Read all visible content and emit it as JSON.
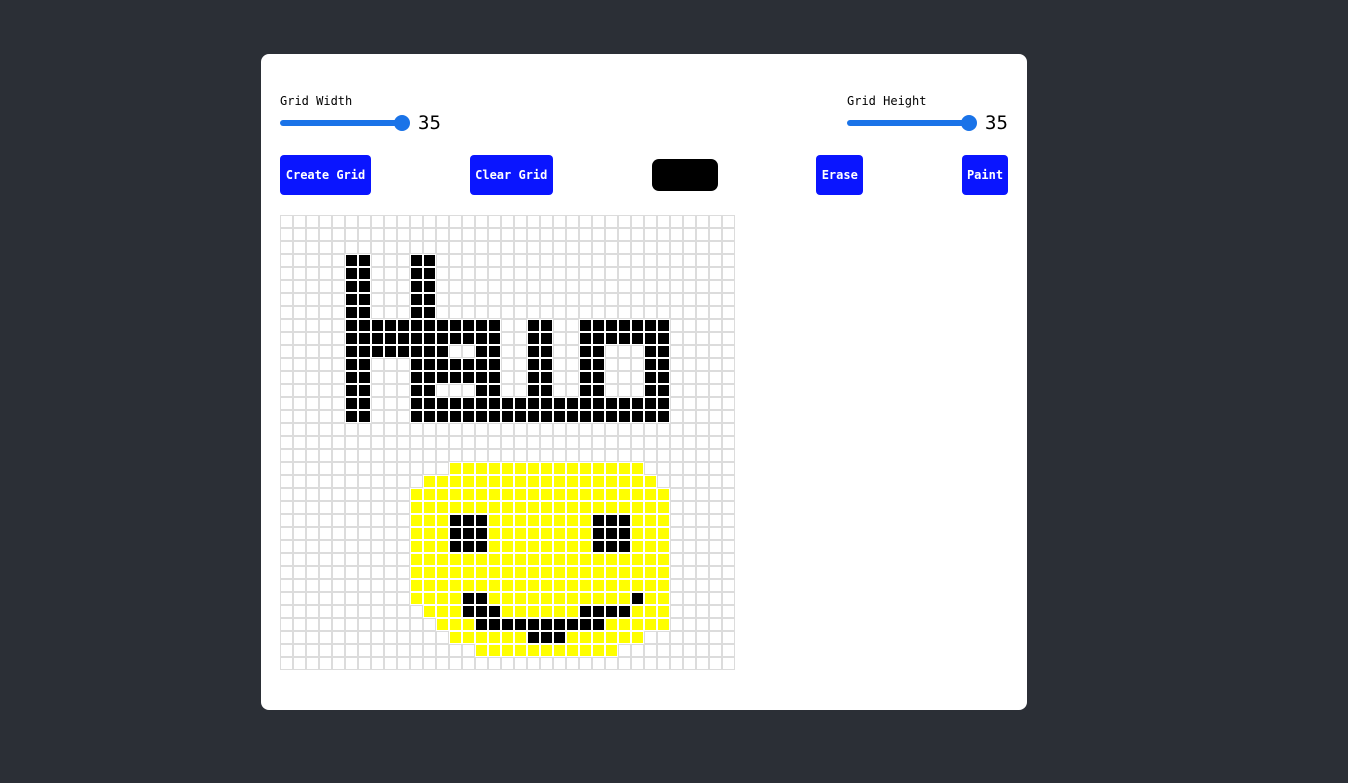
{
  "controls": {
    "grid_width": {
      "label": "Grid Width",
      "value": "35",
      "fraction": 1.0
    },
    "grid_height": {
      "label": "Grid Height",
      "value": "35",
      "fraction": 1.0
    }
  },
  "toolbar": {
    "create_label": "Create Grid",
    "clear_label": "Clear Grid",
    "current_color": "#000000",
    "erase_label": "Erase",
    "paint_label": "Paint"
  },
  "palette": {
    "k": "#000000",
    "y": "#ffff00",
    "empty": "#ffffff",
    "border": "#dcdcdc",
    "accent": "#1a73e8",
    "button": "#0a15ff"
  },
  "grid": {
    "cols": 35,
    "rows": [
      "...................................",
      "...................................",
      "...................................",
      ".....kk...kk.......................",
      ".....kk...kk.......................",
      ".....kk...kk.......................",
      ".....kk...kk.......................",
      ".....kk...kk.......................",
      ".....kkkkkkkkkkkk..kk..kkkkkkk.....",
      ".....kkkkkkkkkkkk..kk..kkkkkkk.....",
      ".....kkkkkkkk..kk..kk..kk...kk.....",
      ".....kk...kkkkkkk..kk..kk...kk.....",
      ".....kk...kkkkkkk..kk..kk...kk.....",
      ".....kk...kk...kk..kk..kk...kk.....",
      ".....kk...kkkkkkkkkkkkkkkkkkkk.....",
      ".....kk...kkkkkkkkkkkkkkkkkkkk.....",
      "...................................",
      "...................................",
      "...................................",
      ".............yyyyyyyyyyyyyyy.......",
      "...........yyyyyyyyyyyyyyyyyy......",
      "..........yyyyyyyyyyyyyyyyyyyy.....",
      "..........yyyyyyyyyyyyyyyyyyyy.....",
      "..........yyykkkyyyyyyyykkkyyy.....",
      "..........yyykkkyyyyyyyykkkyyy.....",
      "..........yyykkkyyyyyyyykkkyyy.....",
      "..........yyyyyyyyyyyyyyyyyyyy.....",
      "..........yyyyyyyyyyyyyyyyyyyy.....",
      "..........yyyyyyyyyyyyyyyyyyyy.....",
      "..........yyyykkyyyyyyyyyyykyy.....",
      "...........yyykkkyyyyyykkkkyyy.....",
      "............yyykkkkkkkkkkyyyyy.....",
      ".............yyyyyykkkyyyyyy.......",
      "...............yyyyyyyyyyy.........",
      "..................................."
    ]
  }
}
